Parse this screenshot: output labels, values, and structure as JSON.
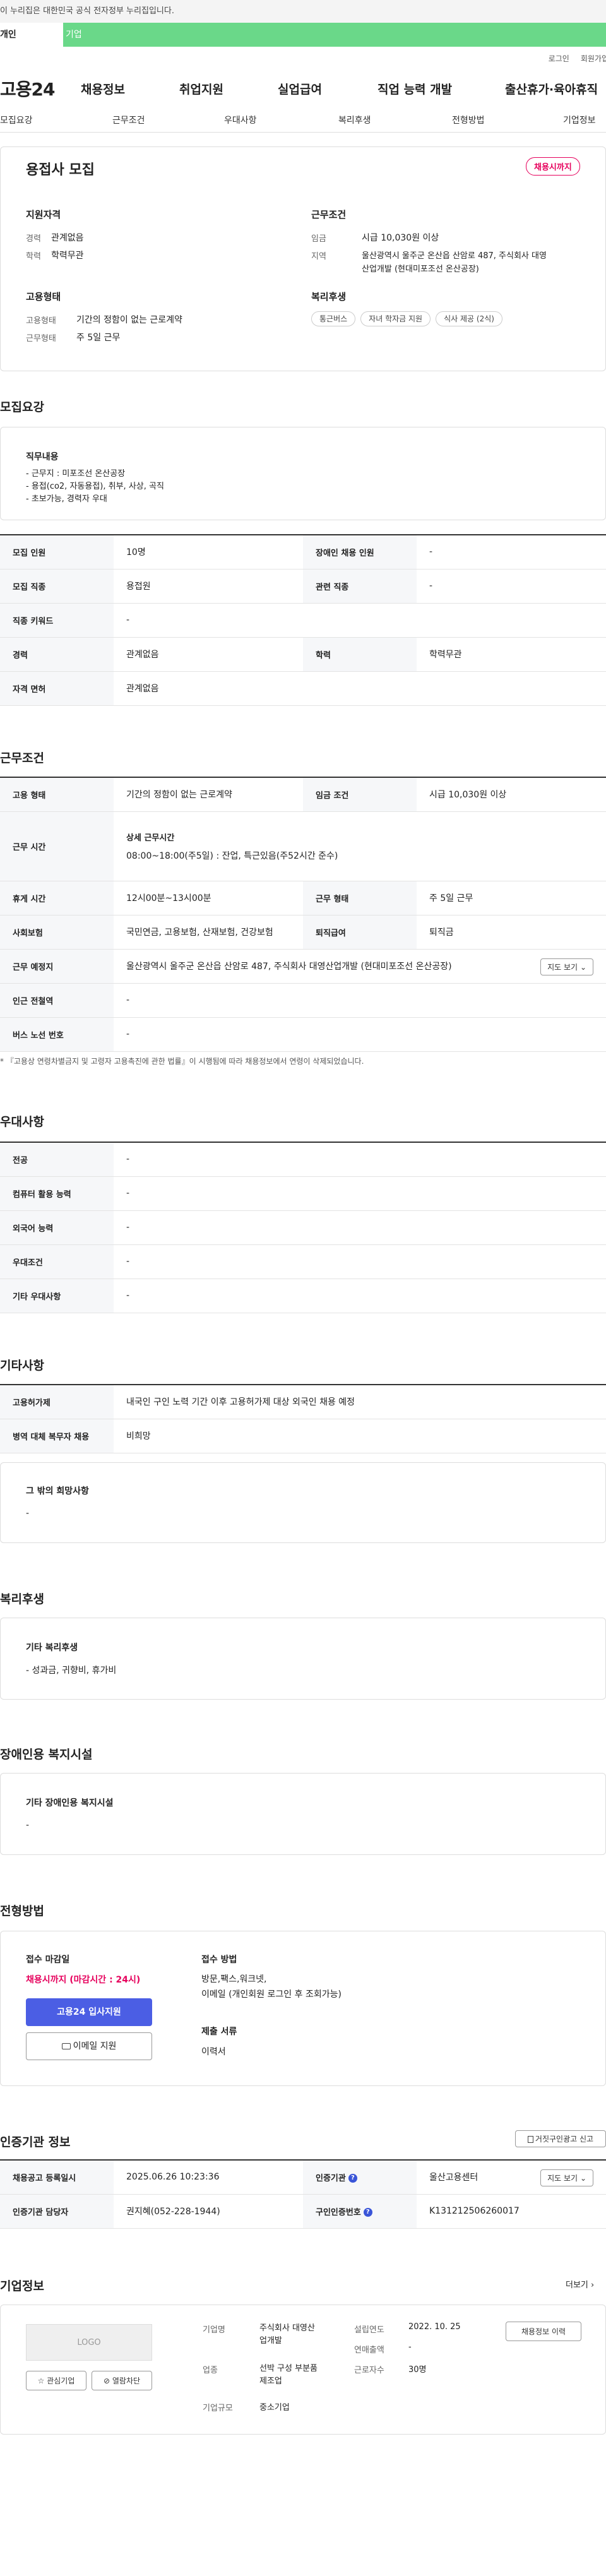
{
  "notice": "이 누리집은 대한민국 공식 전자정부 누리집입니다.",
  "user_tabs": [
    "개인",
    "기업"
  ],
  "util": [
    "로그인",
    "회원가입"
  ],
  "logo": "고용24",
  "gnb": [
    "채용정보",
    "취업지원",
    "실업급여",
    "직업 능력 개발",
    "출산휴가·육아휴직"
  ],
  "lnb": [
    "모집요강",
    "근무조건",
    "우대사항",
    "복리후생",
    "전형방법",
    "기업정보"
  ],
  "summary": {
    "title": "용접사 모집",
    "badge": "채용시까지",
    "qual_title": "지원자격",
    "career_label": "경력",
    "career_value": "관계없음",
    "edu_label": "학력",
    "edu_value": "학력무관",
    "cond_title": "근무조건",
    "wage_label": "임금",
    "wage_value": "시급 10,030원 이상",
    "area_label": "지역",
    "area_value_1": "울산광역시 울주군 온산읍 산암로 487, 주식회사 대영",
    "area_value_2": "산업개발 (현대미포조선 온산공장)",
    "emp_title": "고용형태",
    "emptype_label": "고용형태",
    "emptype_value": "기간의 정함이 없는 근로계약",
    "worktype_label": "근무형태",
    "worktype_value": "주 5일 근무",
    "welfare_title": "복리후생",
    "chips": [
      "통근버스",
      "자녀 학자금 지원",
      "식사 제공 (2식)"
    ]
  },
  "recruit": {
    "title": "모집요강",
    "duty_title": "직무내용",
    "duty_lines": [
      "- 근무지 : 미포조선 온산공장",
      "- 용접(co2, 자동용접), 취부, 사상, 곡직",
      "- 초보가능, 경력자 우대"
    ],
    "rows": [
      [
        "모집 인원",
        "10명",
        "장애인 채용 인원",
        "-"
      ],
      [
        "모집 직종",
        "용접원",
        "관련 직종",
        "-"
      ],
      [
        "직종 키워드",
        "-"
      ],
      [
        "경력",
        "관계없음",
        "학력",
        "학력무관"
      ],
      [
        "자격 면허",
        "관계없음"
      ]
    ]
  },
  "work": {
    "title": "근무조건",
    "emptype_label": "고용 형태",
    "emptype_value": "기간의 정함이 없는 근로계약",
    "wage_label": "임금 조건",
    "wage_value": "시급 10,030원 이상",
    "time_label": "근무 시간",
    "time_sub": "상세 근무시간",
    "time_value": "08:00~18:00(주5일) : 잔업, 특근있음(주52시간 준수)",
    "break_label": "휴게 시간",
    "break_value": "12시00분~13시00분",
    "form_label": "근무 형태",
    "form_value": "주 5일 근무",
    "ins_label": "사회보험",
    "ins_value": "국민연금, 고용보험, 산재보험, 건강보험",
    "sev_label": "퇴직급여",
    "sev_value": "퇴직금",
    "place_label": "근무 예정지",
    "place_value": "울산광역시 울주군 온산읍 산암로 487, 주식회사 대영산업개발 (현대미포조선 온산공장)",
    "map_btn": "지도 보기",
    "station_label": "인근 전철역",
    "station_value": "-",
    "bus_label": "버스 노선 번호",
    "bus_value": "-",
    "note": "* 『고용상 연령차별금지 및 고령자 고용촉진에 관한 법률』이 시행됨에 따라 채용정보에서 연령이 삭제되었습니다."
  },
  "prefer": {
    "title": "우대사항",
    "rows": [
      [
        "전공",
        "-"
      ],
      [
        "컴퓨터 활용 능력",
        "-"
      ],
      [
        "외국어 능력",
        "-"
      ],
      [
        "우대조건",
        "-"
      ],
      [
        "기타 우대사항",
        "-"
      ]
    ]
  },
  "etc": {
    "title": "기타사항",
    "rows": [
      [
        "고용허가제",
        "내국인 구인 노력 기간 이후 고용허가제 대상 외국인 채용 예정"
      ],
      [
        "병역 대체 복무자 채용",
        "비희망"
      ]
    ],
    "hope_title": "그 밖의 희망사항",
    "hope_value": "-"
  },
  "welfare": {
    "title": "복리후생",
    "sub": "기타 복리후생",
    "value": "-  성과금, 귀향비, 휴가비"
  },
  "disabled": {
    "title": "장애인용 복지시설",
    "sub": "기타 장애인용 복지시설",
    "value": "-"
  },
  "select": {
    "title": "전형방법",
    "deadline_title": "접수 마감일",
    "deadline_value": "채용시까지 (마감시간 : 24시)",
    "apply_btn": "고용24 입사지원",
    "email_btn": "이메일 지원",
    "method_title": "접수 방법",
    "method_lines": [
      "방문,팩스,워크넷,",
      "이메일 (개인회원 로그인 후 조회가능)"
    ],
    "docs_title": "제출 서류",
    "docs_value": "이력서"
  },
  "agency": {
    "title": "인증기관 정보",
    "report_btn": "거짓구인광고 신고",
    "reg_label": "채용공고 등록일시",
    "reg_value": "2025.06.26 10:23:36",
    "org_label": "인증기관",
    "org_value": "울산고용센터",
    "map_btn": "지도 보기",
    "staff_label": "인증기관 담당자",
    "staff_value": "권지혜(052-228-1944)",
    "no_label": "구인인증번호",
    "no_value": "K131212506260017"
  },
  "company": {
    "title": "기업정보",
    "more": "더보기",
    "logo": "LOGO",
    "fav_btn": "관심기업",
    "block_btn": "열람차단",
    "name_label": "기업명",
    "name_value_1": "주식회사 대영산",
    "name_value_2": "업개발",
    "year_label": "설립연도",
    "year_value": "2022. 10. 25",
    "sales_label": "연매출액",
    "sales_value": "-",
    "ind_label": "업종",
    "ind_value_1": "선박 구성 부분품",
    "ind_value_2": "제조업",
    "emp_label": "근로자수",
    "emp_value": "30명",
    "size_label": "기업규모",
    "size_value": "중소기업",
    "jobs_btn": "채용정보 이력"
  }
}
